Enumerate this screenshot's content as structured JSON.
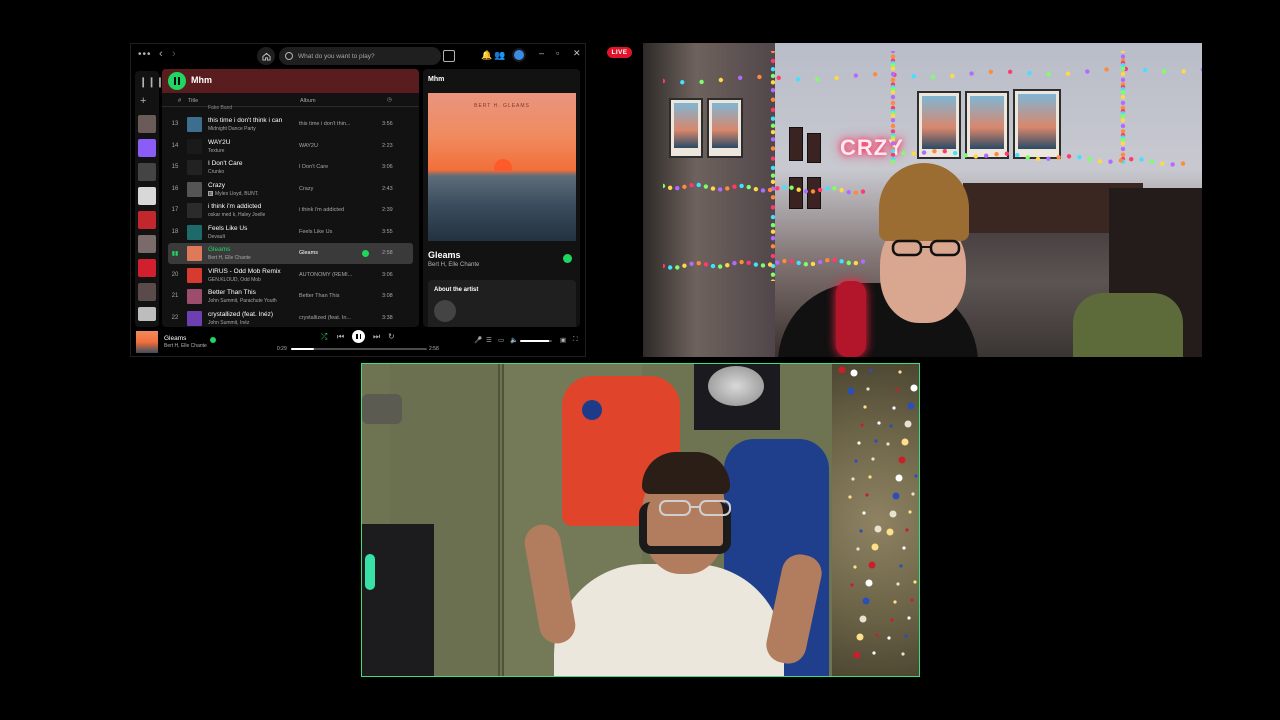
{
  "stream": {
    "live_label": "LIVE"
  },
  "spotify": {
    "search_placeholder": "What do you want to play?",
    "playlist_title": "Mhm",
    "columns": {
      "num": "#",
      "title": "Title",
      "album": "Album"
    },
    "partial_row_text": "Fake Band",
    "tracks": [
      {
        "num": "13",
        "title": "this time i don't think i can",
        "artist": "Midnight Dance Party",
        "album": "this time i don't thin...",
        "duration": "3:56",
        "cover": "#3c6f8f"
      },
      {
        "num": "14",
        "title": "WAY2U",
        "artist": "Texture",
        "album": "WAY2U",
        "duration": "2:23",
        "cover": "#1a1a1a"
      },
      {
        "num": "15",
        "title": "I Don't Care",
        "artist": "Crunko",
        "album": "I Don't Care",
        "duration": "3:06",
        "cover": "#222222"
      },
      {
        "num": "16",
        "title": "Crazy",
        "artist": "Myles Lloyd, BUNT.",
        "album": "Crazy",
        "duration": "2:43",
        "cover": "#555555",
        "explicit": "E"
      },
      {
        "num": "17",
        "title": "i think i'm addicted",
        "artist": "oskar med k, Haley Joelle",
        "album": "i think i'm addicted",
        "duration": "2:39",
        "cover": "#2b2b2b"
      },
      {
        "num": "18",
        "title": "Feels Like Us",
        "artist": "Devault",
        "album": "Feels Like Us",
        "duration": "3:55",
        "cover": "#1e6a6a"
      },
      {
        "num": "19",
        "title": "Gleams",
        "artist": "Bert H, Elle Chante",
        "album": "Gleams",
        "duration": "2:58",
        "cover": "#e0795a",
        "active": true
      },
      {
        "num": "20",
        "title": "VIRUS - Odd Mob Remix",
        "artist": "GEN.KLOUD, Odd Mob",
        "album": "AUTONOMY (REMI...",
        "duration": "3:06",
        "cover": "#d63b2f"
      },
      {
        "num": "21",
        "title": "Better Than This",
        "artist": "John Summit, Parachute Youth",
        "album": "Better Than This",
        "duration": "3:08",
        "cover": "#9c4d6d"
      },
      {
        "num": "22",
        "title": "crystallized (feat. Inéz)",
        "artist": "John Summit, Inéz",
        "album": "crystallized (feat. In...",
        "duration": "3:38",
        "cover": "#6e3fb0"
      }
    ],
    "now_playing": {
      "panel_title": "Mhm",
      "art_text": "BERT H. GLEAMS",
      "song": "Gleams",
      "artist": "Bert H, Elle Chante",
      "about_label": "About the artist"
    },
    "player": {
      "song": "Gleams",
      "artist": "Bert H, Elle Chante",
      "elapsed": "0:29",
      "total": "2:58",
      "progress_fraction": 0.17,
      "volume_fraction": 0.9
    },
    "accent": "#1ed760"
  },
  "webcam1": {
    "neon_sign": "CRZY"
  }
}
